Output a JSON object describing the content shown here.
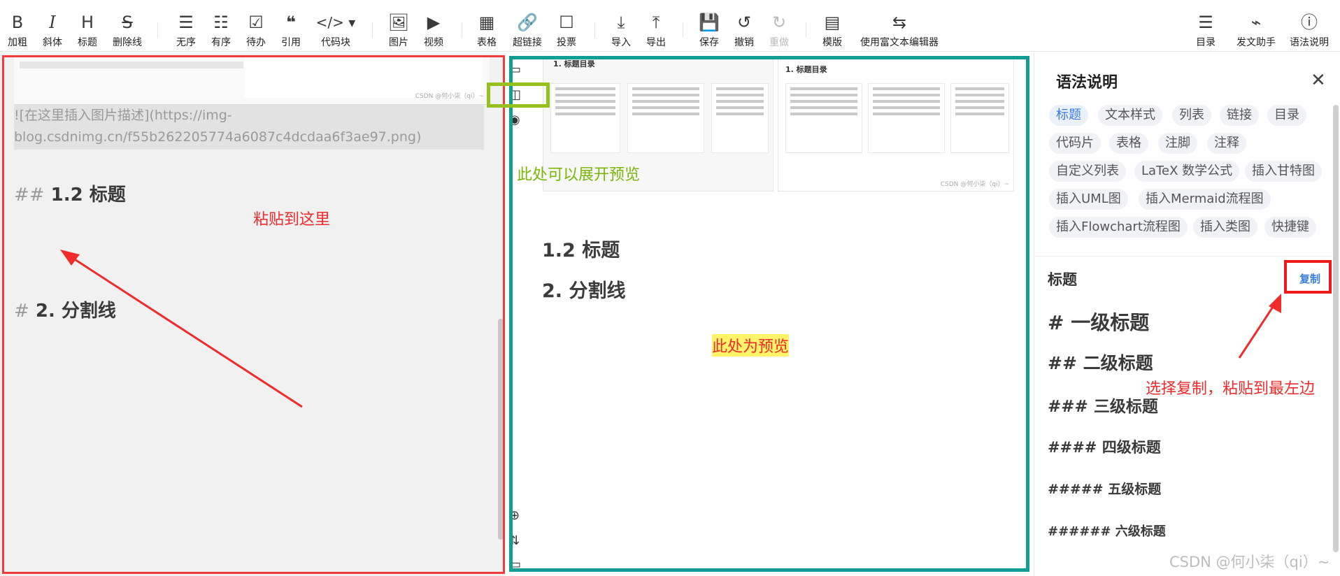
{
  "toolbar": {
    "bold": "加粗",
    "italic": "斜体",
    "heading": "标题",
    "strike": "删除线",
    "ul": "无序",
    "ol": "有序",
    "todo": "待办",
    "quote": "引用",
    "code": "代码块",
    "image": "图片",
    "video": "视频",
    "table": "表格",
    "link": "超链接",
    "vote": "投票",
    "import": "导入",
    "export": "导出",
    "save": "保存",
    "undo": "撤销",
    "redo": "重做",
    "template": "模版",
    "richtext": "使用富文本编辑器",
    "toc": "目录",
    "assistant": "发文助手",
    "syntax": "语法说明"
  },
  "editor": {
    "thumb_sig": "CSDN @何小柒（qi）~",
    "image_md": "![在这里插入图片描述](https://img-blog.csdnimg.cn/f55b262205774a6087c4dcdaa6f3ae97.png)",
    "h2_mark": "##",
    "h2_text": "1.2 标题",
    "h1_mark": "#",
    "h1_text": "2. 分割线",
    "annotation": "粘贴到这里"
  },
  "preview": {
    "thumb_title_left": "1. 标题目录",
    "thumb_title_right": "1. 标题目录",
    "thumb_sig": "CSDN @何小柒（qi）~",
    "h2_text": "1.2 标题",
    "h1_text": "2. 分割线",
    "annotation_expand": "此处可以展开预览",
    "annotation_preview": "此处为预览"
  },
  "help": {
    "title": "语法说明",
    "tags": [
      "标题",
      "文本样式",
      "列表",
      "链接",
      "目录",
      "代码片",
      "表格",
      "注脚",
      "注释",
      "自定义列表",
      "LaTeX 数学公式",
      "插入甘特图",
      "插入UML图",
      "插入Mermaid流程图",
      "插入Flowchart流程图",
      "插入类图",
      "快捷键"
    ],
    "section_title": "标题",
    "copy_label": "复制",
    "headings": [
      "# 一级标题",
      "## 二级标题",
      "### 三级标题",
      "#### 四级标题",
      "##### 五级标题",
      "###### 六级标题"
    ],
    "annotation": "选择复制，粘贴到最左边"
  },
  "watermark": "CSDN @何小柒（qi）~",
  "colors": {
    "annotation_red": "#ef2b2b",
    "annotation_green": "#79b70a",
    "teal_border": "#129e94",
    "green_border": "#96c11f",
    "accent_blue": "#3b7ddd",
    "highlight_yellow": "#fff36a"
  }
}
